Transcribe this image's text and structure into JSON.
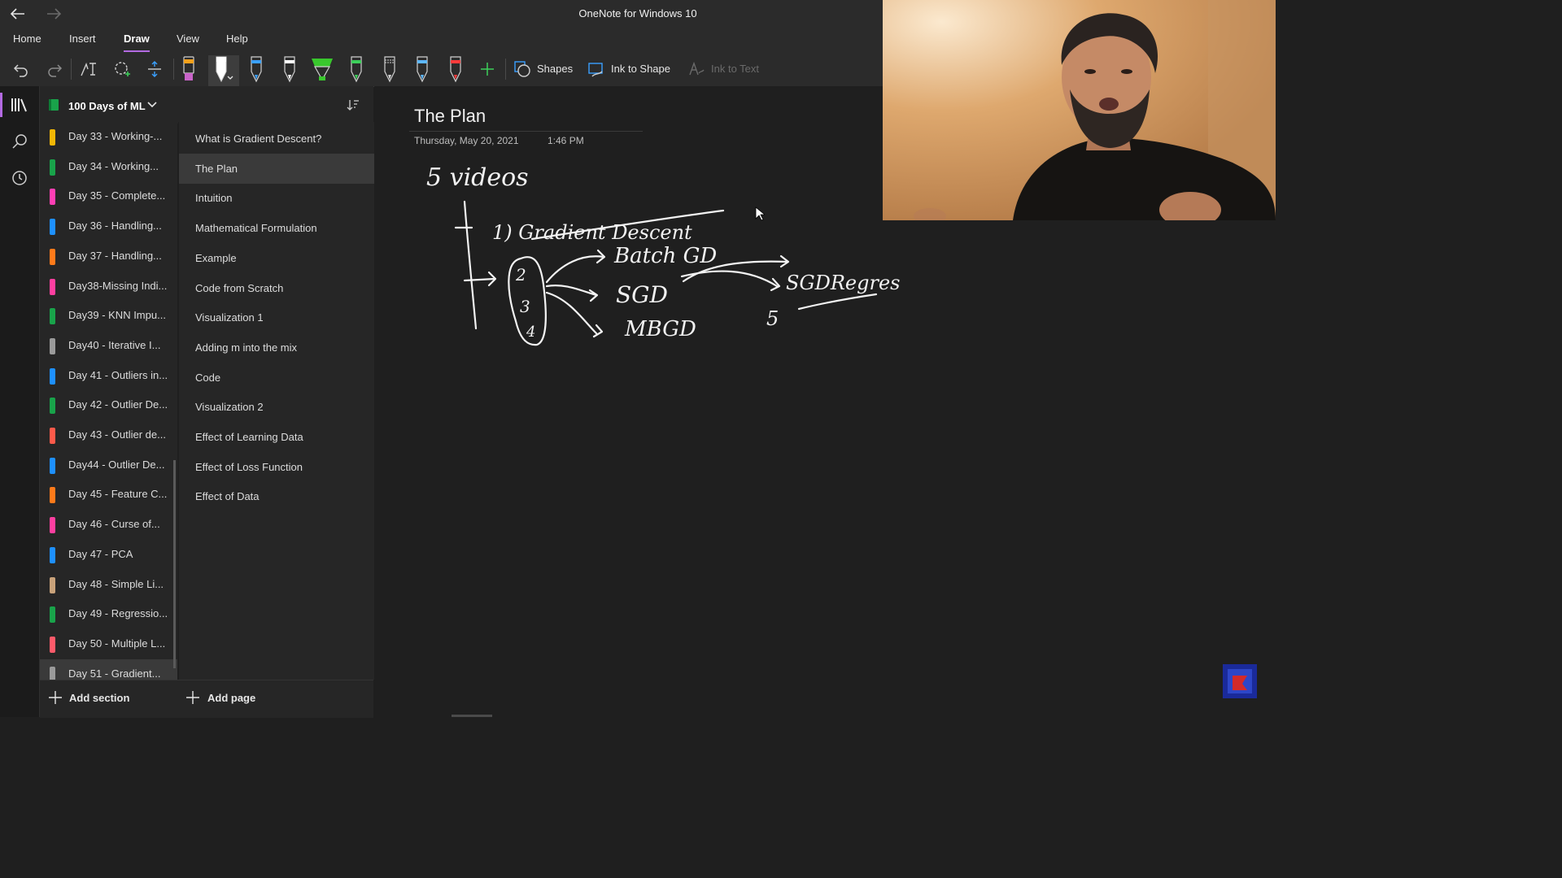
{
  "window": {
    "title": "OneNote for Windows 10"
  },
  "menu": {
    "items": [
      "Home",
      "Insert",
      "Draw",
      "View",
      "Help"
    ],
    "active": "Draw"
  },
  "toolbar": {
    "shapes_label": "Shapes",
    "ink_to_shape_label": "Ink to Shape",
    "ink_to_text_label": "Ink to Text",
    "pens": [
      {
        "name": "highlighter-yellow-pen",
        "color": "#f7a11b"
      },
      {
        "name": "white-pen",
        "color": "#ffffff"
      },
      {
        "name": "blue-pen",
        "color": "#3aa0ff"
      },
      {
        "name": "white-pen-2",
        "color": "#ffffff"
      },
      {
        "name": "green-highlighter",
        "color": "#39c72d"
      },
      {
        "name": "green-pen",
        "color": "#3ccf5a"
      },
      {
        "name": "white-pencil",
        "color": "#d0d0d0"
      },
      {
        "name": "light-blue-pen",
        "color": "#5db8ff"
      },
      {
        "name": "red-pen",
        "color": "#ff3b3b"
      }
    ]
  },
  "notebook": {
    "name": "100 Days of ML"
  },
  "sections": [
    {
      "label": "Day 33 - Working-...",
      "color": "#f2b705"
    },
    {
      "label": "Day 34 - Working...",
      "color": "#19a34a"
    },
    {
      "label": "Day 35 - Complete...",
      "color": "#ff3fb4"
    },
    {
      "label": "Day 36 - Handling...",
      "color": "#1e90ff"
    },
    {
      "label": "Day 37 - Handling...",
      "color": "#ff7a1a"
    },
    {
      "label": "Day38-Missing Indi...",
      "color": "#ff3fa0"
    },
    {
      "label": "Day39 - KNN Impu...",
      "color": "#19a34a"
    },
    {
      "label": "Day40 - Iterative I...",
      "color": "#9a9a9a"
    },
    {
      "label": "Day 41 - Outliers in...",
      "color": "#1e90ff"
    },
    {
      "label": "Day 42 - Outlier De...",
      "color": "#19a34a"
    },
    {
      "label": "Day 43 - Outlier de...",
      "color": "#ff5a4a"
    },
    {
      "label": "Day44 - Outlier De...",
      "color": "#1e90ff"
    },
    {
      "label": "Day 45 - Feature C...",
      "color": "#ff7a1a"
    },
    {
      "label": "Day 46 - Curse of...",
      "color": "#ff3fa0"
    },
    {
      "label": "Day 47 - PCA",
      "color": "#1e90ff"
    },
    {
      "label": "Day 48 - Simple Li...",
      "color": "#c9a27a"
    },
    {
      "label": "Day 49 - Regressio...",
      "color": "#19a34a"
    },
    {
      "label": "Day 50 - Multiple L...",
      "color": "#ff5a6a"
    },
    {
      "label": "Day 51 - Gradient...",
      "color": "#9a9a9a"
    }
  ],
  "selected_section": "Day 51 - Gradient...",
  "pages": [
    "What is Gradient Descent?",
    "The Plan",
    "Intuition",
    "Mathematical Formulation",
    "Example",
    "Code from Scratch",
    "Visualization 1",
    "Adding m into the mix",
    "Code",
    "Visualization 2",
    "Effect of Learning Data",
    "Effect of Loss Function",
    "Effect of Data"
  ],
  "selected_page": "The Plan",
  "add_section_label": "Add section",
  "add_page_label": "Add page",
  "note": {
    "title": "The Plan",
    "date": "Thursday, May 20, 2021",
    "time": "1:46 PM"
  },
  "ink_text": {
    "heading": "5 videos",
    "item1": "1) Gradient Descent",
    "batch": "Batch GD",
    "sgd": "SGD",
    "mbgd": "MBGD",
    "sgd_regress": "SGDRegres",
    "five": "5",
    "numbers": [
      "2",
      "3",
      "4"
    ]
  }
}
